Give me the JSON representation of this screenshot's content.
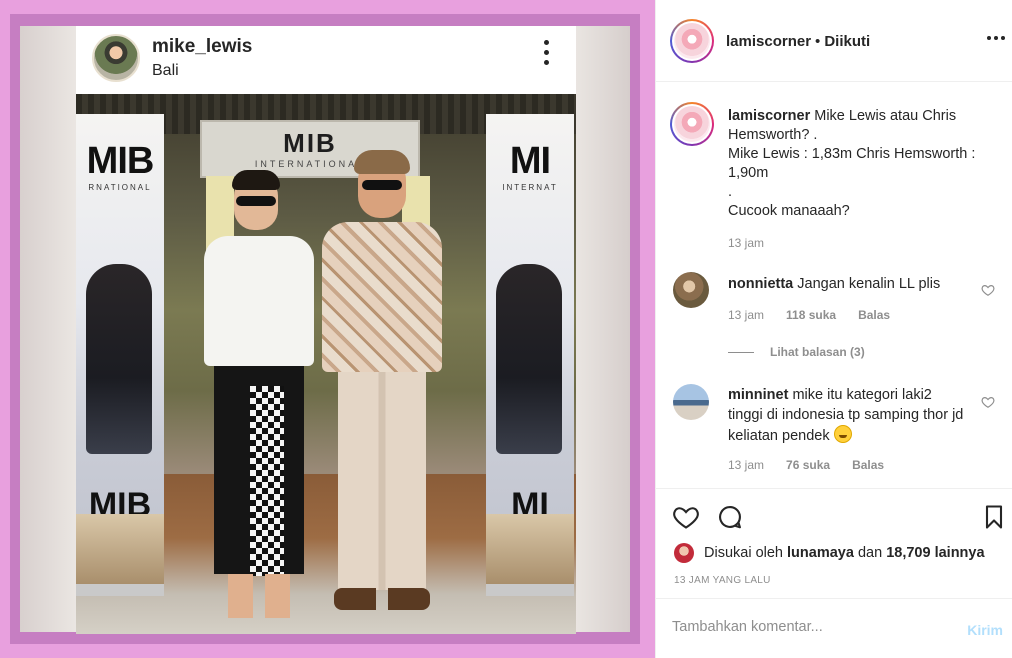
{
  "post_image": {
    "username": "mike_lewis",
    "location": "Bali",
    "scene": {
      "sign_main": "MIB",
      "sign_sub": "INTERNATIONAL",
      "banner_left_top": "MIB",
      "banner_left_sub": "RNATIONAL",
      "banner_left_bottom": "MIB",
      "banner_right_top": "MI",
      "banner_right_sub": "INTERNAT",
      "banner_right_bottom": "MI"
    }
  },
  "header": {
    "username": "lamiscorner",
    "separator": "•",
    "follow_status": "Diikuti"
  },
  "caption": {
    "username": "lamiscorner",
    "lines": [
      "Mike Lewis atau Chris Hemsworth? .",
      "Mike Lewis : 1,83m Chris Hemsworth : 1,90m",
      ".",
      "Cucook manaaah?"
    ],
    "time": "13 jam"
  },
  "comments": [
    {
      "username": "nonnietta",
      "text": "Jangan kenalin LL plis",
      "time": "13 jam",
      "likes": "118 suka",
      "reply": "Balas",
      "view_replies": "Lihat balasan (3)"
    },
    {
      "username": "minninet",
      "text": "mike itu kategori laki2 tinggi di indonesia tp samping thor jd keliatan pendek",
      "time": "13 jam",
      "likes": "76 suka",
      "reply": "Balas"
    }
  ],
  "likes": {
    "prefix": "Disukai oleh",
    "user": "lunamaya",
    "middle": "dan",
    "count": "18,709 lainnya"
  },
  "posted_ago": "13 JAM YANG LALU",
  "comment_input": {
    "placeholder": "Tambahkan komentar...",
    "send_label": "Kirim"
  },
  "colors": {
    "frame_pink": "#e8a0de",
    "frame_inner": "#c67ec2",
    "send_disabled": "#b2dffc",
    "meta_gray": "#8e8e8e"
  },
  "icons": [
    "more-icon",
    "heart-icon",
    "comment-icon",
    "bookmark-icon",
    "small-heart-icon",
    "grin-emoji"
  ]
}
